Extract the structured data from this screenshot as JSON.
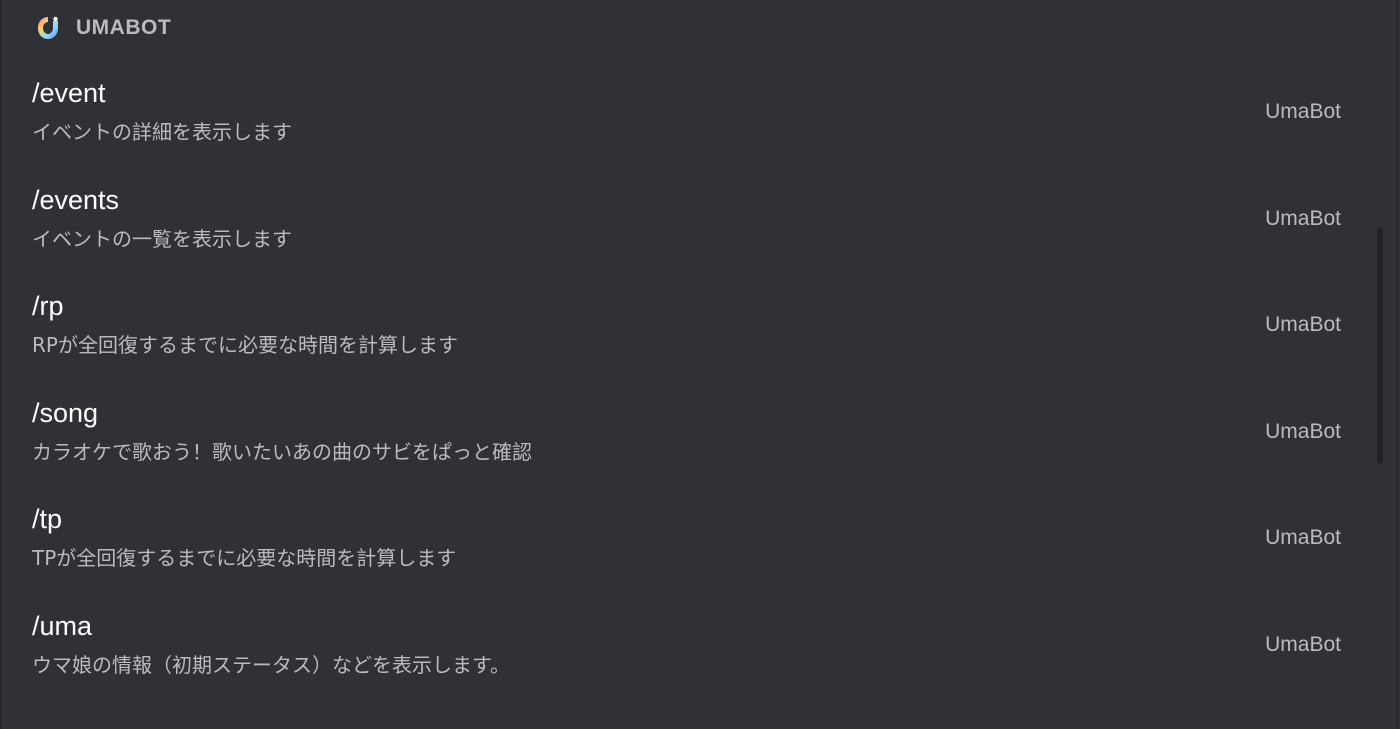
{
  "app": {
    "title": "UMABOT",
    "icon": "umabot-logo-icon"
  },
  "colors": {
    "background": "#2f3136",
    "command_name": "#ffffff",
    "secondary_text": "#b9bbbe",
    "scrollbar_thumb": "#202225"
  },
  "commands": [
    {
      "name": "/event",
      "description": "イベントの詳細を表示します",
      "source": "UmaBot"
    },
    {
      "name": "/events",
      "description": "イベントの一覧を表示します",
      "source": "UmaBot"
    },
    {
      "name": "/rp",
      "description": "RPが全回復するまでに必要な時間を計算します",
      "source": "UmaBot"
    },
    {
      "name": "/song",
      "description": "カラオケで歌おう！歌いたいあの曲のサビをぱっと確認",
      "source": "UmaBot"
    },
    {
      "name": "/tp",
      "description": "TPが全回復するまでに必要な時間を計算します",
      "source": "UmaBot"
    },
    {
      "name": "/uma",
      "description": "ウマ娘の情報（初期ステータス）などを表示します。",
      "source": "UmaBot"
    }
  ]
}
